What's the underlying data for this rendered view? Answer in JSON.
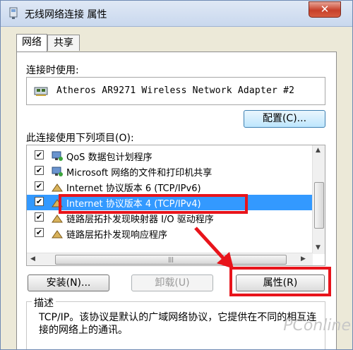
{
  "window": {
    "title": "无线网络连接 属性",
    "close_label": "✕"
  },
  "tabs": [
    {
      "label": "网络"
    },
    {
      "label": "共享"
    }
  ],
  "connect_using_label": "连接时使用:",
  "adapter_name": "Atheros AR9271 Wireless Network Adapter #2",
  "configure_button": "配置(C)...",
  "items_label": "此连接使用下列项目(O):",
  "items": [
    {
      "label": "QoS 数据包计划程序",
      "checked": true
    },
    {
      "label": "Microsoft 网络的文件和打印机共享",
      "checked": true
    },
    {
      "label": "Internet 协议版本 6 (TCP/IPv6)",
      "checked": true
    },
    {
      "label": "Internet 协议版本 4 (TCP/IPv4)",
      "checked": true
    },
    {
      "label": "链路层拓扑发现映射器 I/O 驱动程序",
      "checked": true
    },
    {
      "label": "链路层拓扑发现响应程序",
      "checked": true
    }
  ],
  "buttons": {
    "install": "安装(N)...",
    "uninstall": "卸载(U)",
    "properties": "属性(R)"
  },
  "description": {
    "title": "描述",
    "text": "TCP/IP。该协议是默认的广域网络协议，它提供在不同的相互连接的网络上的通讯。"
  },
  "watermark": "PConline",
  "colors": {
    "highlight_box": "#e8141b",
    "selection": "#3399ff"
  }
}
